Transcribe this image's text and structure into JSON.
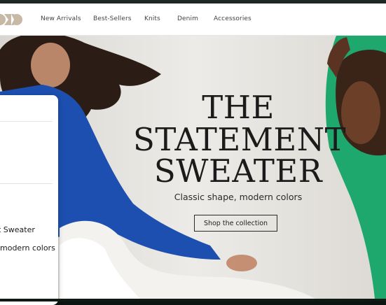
{
  "nav": {
    "items": [
      "New Arrivals",
      "Best-Sellers",
      "Knits",
      "Denim",
      "Accessories"
    ]
  },
  "hero": {
    "title_lines": [
      "THE",
      "STATEMENT",
      "SWEATER"
    ],
    "subtitle": "Classic shape, modern colors",
    "cta_label": "Shop the collection"
  },
  "panel": {
    "title_fragment": "t Sweater",
    "subtitle_fragment": "modern colors"
  },
  "colors": {
    "logo": "#c8b8a6",
    "sweater_blue": "#1c4fb0",
    "sweater_green": "#1fa86e",
    "background": "#e6e3df"
  }
}
